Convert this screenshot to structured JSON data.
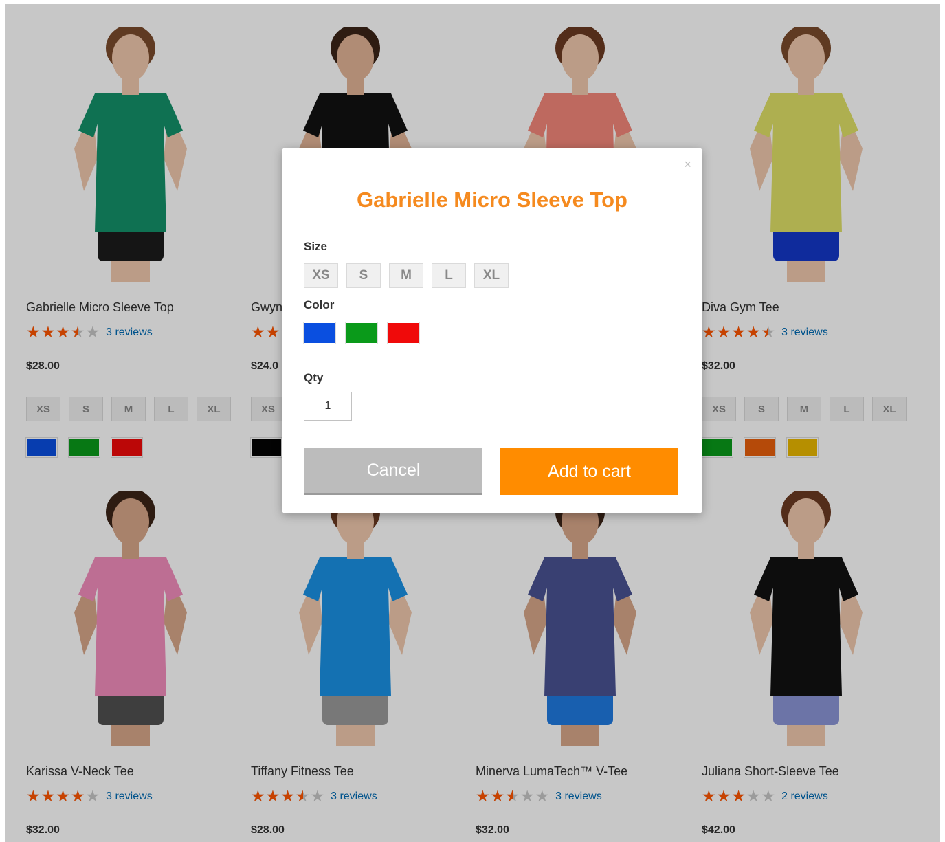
{
  "colors": {
    "accent": "#ff8c00",
    "title": "#f58a1f",
    "star": "#ff5501",
    "link": "#006bb4"
  },
  "products": [
    {
      "name": "Gabrielle Micro Sleeve Top",
      "rating": 3.5,
      "reviews": "3 reviews",
      "price": "$28.00",
      "sizes": [
        "XS",
        "S",
        "M",
        "L",
        "XL"
      ],
      "colors": [
        "#0a4fe0",
        "#0a9a1a",
        "#f00a0a"
      ],
      "shirt": "#14916a",
      "bottom": "#1c1c1c",
      "hair": "#7a4b2c",
      "skin": "#f0c8ad"
    },
    {
      "name": "Gwyn",
      "rating": 2,
      "reviews": "",
      "price": "$24.0",
      "sizes": [
        "XS"
      ],
      "colors": [
        "#050505"
      ],
      "shirt": "#111111",
      "bottom": "#1c1c1c",
      "hair": "#3b2418",
      "skin": "#e2b496"
    },
    {
      "name": "",
      "rating": 0,
      "reviews": "",
      "price": "",
      "sizes": [],
      "colors": [],
      "shirt": "#f4877a",
      "bottom": "#1c1c1c",
      "hair": "#6b3a22",
      "skin": "#f0c8ad"
    },
    {
      "name": "Diva Gym Tee",
      "rating": 4.5,
      "reviews": "3 reviews",
      "price": "$32.00",
      "sizes": [
        "XS",
        "S",
        "M",
        "L",
        "XL"
      ],
      "colors": [
        "#0a9a1a",
        "#e85f0c",
        "#eab800"
      ],
      "shirt": "#dfe067",
      "bottom": "#1438c8",
      "hair": "#7a4b2c",
      "skin": "#f0c8ad"
    },
    {
      "name": "Karissa V-Neck Tee",
      "rating": 4,
      "reviews": "3 reviews",
      "price": "$32.00",
      "sizes": [],
      "colors": [],
      "shirt": "#f28ebd",
      "bottom": "#505050",
      "hair": "#3b2418",
      "skin": "#d8a78a"
    },
    {
      "name": "Tiffany Fitness Tee",
      "rating": 3.5,
      "reviews": "3 reviews",
      "price": "$28.00",
      "sizes": [],
      "colors": [],
      "shirt": "#1a91e5",
      "bottom": "#9a9a9a",
      "hair": "#6b3a22",
      "skin": "#f0c8ad"
    },
    {
      "name": "Minerva LumaTech™ V-Tee",
      "rating": 2.5,
      "reviews": "3 reviews",
      "price": "$32.00",
      "sizes": [],
      "colors": [],
      "shirt": "#4a5292",
      "bottom": "#1f7ae0",
      "hair": "#3b2418",
      "skin": "#d8a78a"
    },
    {
      "name": "Juliana Short-Sleeve Tee",
      "rating": 3,
      "reviews": "2 reviews",
      "price": "$42.00",
      "sizes": [],
      "colors": [],
      "shirt": "#111111",
      "bottom": "#8b95d6",
      "hair": "#6b3a22",
      "skin": "#f0c8ad"
    }
  ],
  "modal": {
    "close_icon": "×",
    "title": "Gabrielle Micro Sleeve Top",
    "size_label": "Size",
    "sizes": [
      "XS",
      "S",
      "M",
      "L",
      "XL"
    ],
    "color_label": "Color",
    "colors": [
      "#0a4fe0",
      "#0a9a1a",
      "#f00a0a"
    ],
    "qty_label": "Qty",
    "qty_value": "1",
    "cancel_label": "Cancel",
    "add_label": "Add to cart"
  }
}
